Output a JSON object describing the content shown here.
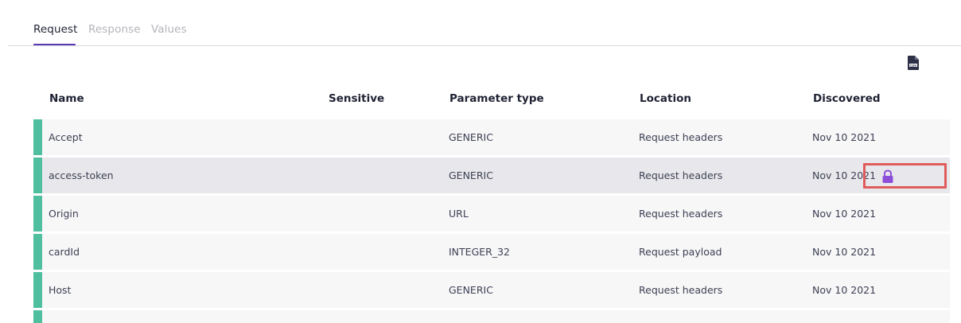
{
  "tabs": [
    {
      "label": "Request",
      "active": true
    },
    {
      "label": "Response",
      "active": false
    },
    {
      "label": "Values",
      "active": false
    }
  ],
  "toolbar": {
    "export_icon": "csv-file-icon"
  },
  "table": {
    "columns": [
      "Name",
      "Sensitive",
      "Parameter type",
      "Location",
      "Discovered"
    ],
    "rows": [
      {
        "name": "Accept",
        "sensitive": "",
        "type": "GENERIC",
        "location": "Request headers",
        "discovered": "Nov 10 2021"
      },
      {
        "name": "access-token",
        "sensitive": "",
        "type": "GENERIC",
        "location": "Request headers",
        "discovered": "Nov 10 2021"
      },
      {
        "name": "Origin",
        "sensitive": "",
        "type": "URL",
        "location": "Request headers",
        "discovered": "Nov 10 2021"
      },
      {
        "name": "cardId",
        "sensitive": "",
        "type": "INTEGER_32",
        "location": "Request payload",
        "discovered": "Nov 10 2021"
      },
      {
        "name": "Host",
        "sensitive": "",
        "type": "GENERIC",
        "location": "Request headers",
        "discovered": "Nov 10 2021"
      }
    ]
  },
  "colors": {
    "accent": "#5b3bb5",
    "row_marker": "#4fbf9f",
    "lock": "#8e4fd8",
    "highlight_box": "#e05b5b"
  },
  "icons": {
    "row_action": "lock-icon"
  }
}
